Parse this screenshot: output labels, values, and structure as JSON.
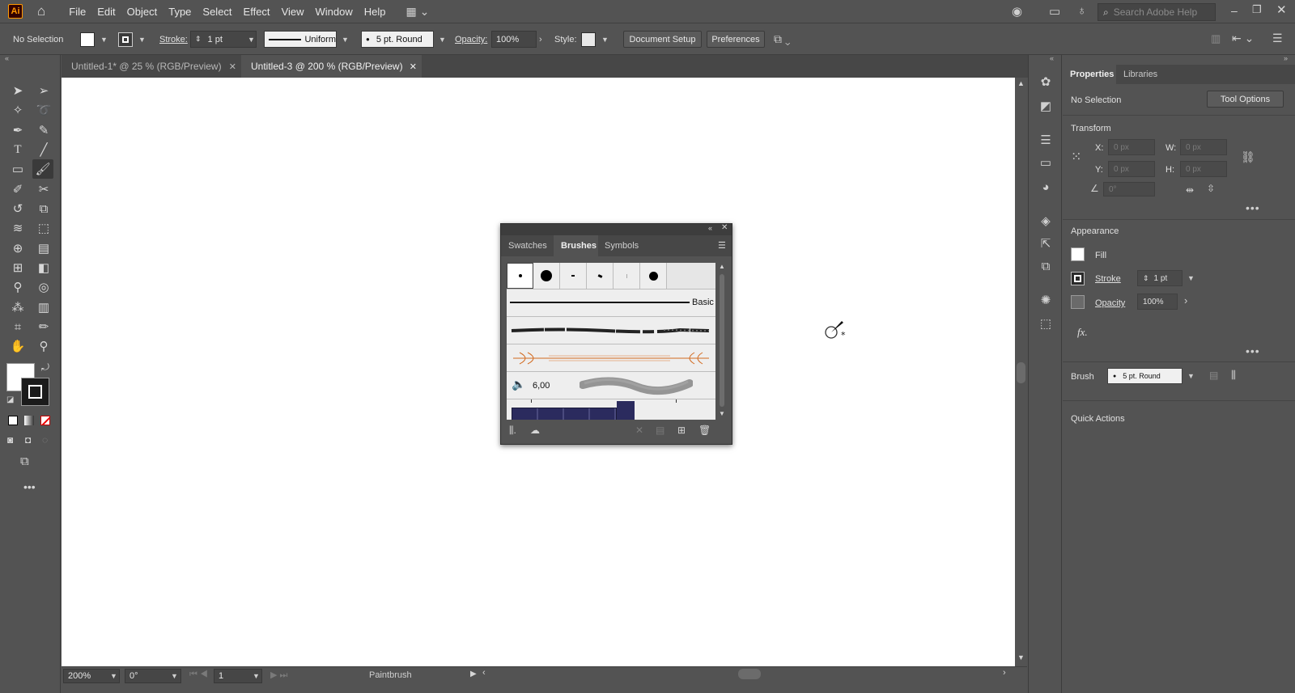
{
  "app": {
    "logo": "Ai"
  },
  "menu": [
    "File",
    "Edit",
    "Object",
    "Type",
    "Select",
    "Effect",
    "View",
    "Window",
    "Help"
  ],
  "search": {
    "placeholder": "Search Adobe Help"
  },
  "control": {
    "selection": "No Selection",
    "stroke_label": "Stroke:",
    "stroke_value": "1 pt",
    "profile": "Uniform",
    "brush": "5 pt. Round",
    "opacity_label": "Opacity:",
    "opacity_value": "100%",
    "style_label": "Style:",
    "doc_setup": "Document Setup",
    "preferences": "Preferences"
  },
  "tabs": [
    {
      "label": "Untitled-1* @ 25 % (RGB/Preview)",
      "active": false
    },
    {
      "label": "Untitled-3 @ 200 % (RGB/Preview)",
      "active": true
    }
  ],
  "status": {
    "zoom": "200%",
    "rotation": "0°",
    "artboard": "1",
    "tool": "Paintbrush"
  },
  "properties": {
    "tabs": [
      "Properties",
      "Libraries"
    ],
    "selection": "No Selection",
    "tool_options": "Tool Options",
    "transform": {
      "title": "Transform",
      "x_label": "X:",
      "y_label": "Y:",
      "w_label": "W:",
      "h_label": "H:",
      "x": "0 px",
      "y": "0 px",
      "w": "0 px",
      "h": "0 px",
      "angle": "0°"
    },
    "appearance": {
      "title": "Appearance",
      "fill": "Fill",
      "stroke": "Stroke",
      "stroke_value": "1 pt",
      "opacity": "Opacity",
      "opacity_value": "100%",
      "fx": "fx."
    },
    "brush": {
      "label": "Brush",
      "value": "5 pt. Round"
    },
    "quick_actions": "Quick Actions"
  },
  "brushes_panel": {
    "tabs": [
      "Swatches",
      "Brushes",
      "Symbols"
    ],
    "active_tab": "Brushes",
    "basic_label": "Basic",
    "pressure_value": "6,00"
  },
  "colors": {
    "accent": "#ff9a00",
    "ui_bg": "#535353",
    "canvas": "#ffffff",
    "art_brush_orange": "#d2691e",
    "pattern_navy": "#2b2b5e"
  }
}
